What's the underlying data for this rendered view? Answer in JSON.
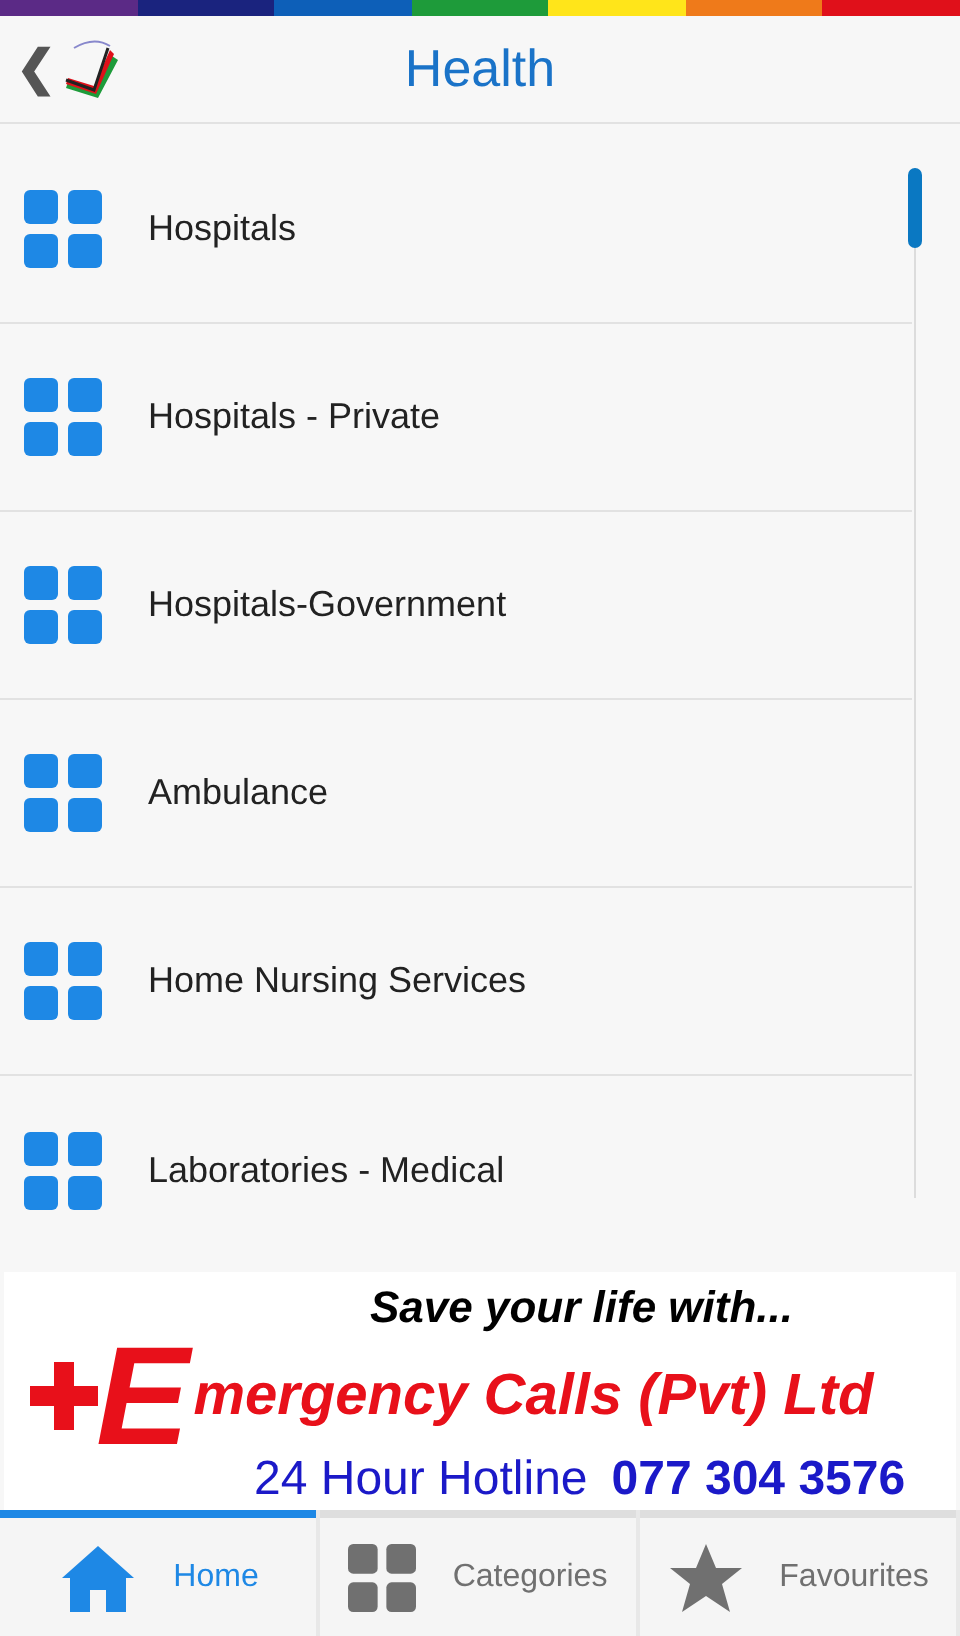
{
  "header": {
    "back": "❮",
    "title": "Health"
  },
  "items": [
    {
      "label": "Hospitals"
    },
    {
      "label": "Hospitals - Private"
    },
    {
      "label": "Hospitals-Government"
    },
    {
      "label": "Ambulance"
    },
    {
      "label": "Home Nursing Services"
    },
    {
      "label": "Laboratories - Medical"
    }
  ],
  "banner": {
    "tagline": "Save your life with...",
    "logo_letter": "E",
    "company": "mergency Calls (Pvt) Ltd",
    "hotline_label": "24 Hour Hotline",
    "hotline_number": "077 304 3576"
  },
  "tabs": [
    {
      "kind": "home",
      "label": "Home",
      "selected": true
    },
    {
      "kind": "categories",
      "label": "Categories",
      "selected": false
    },
    {
      "kind": "favourites",
      "label": "Favourites",
      "selected": false
    }
  ]
}
